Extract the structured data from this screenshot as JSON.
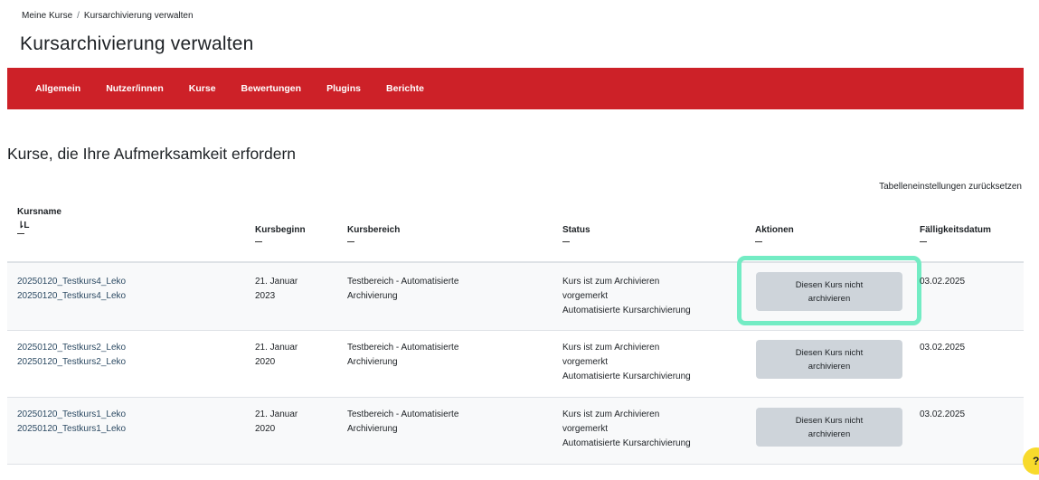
{
  "breadcrumb": {
    "item1": "Meine Kurse",
    "separator": "/",
    "item2": "Kursarchivierung verwalten"
  },
  "page_title": "Kursarchivierung verwalten",
  "nav": [
    "Allgemein",
    "Nutzer/innen",
    "Kurse",
    "Bewertungen",
    "Plugins",
    "Berichte"
  ],
  "section_title": "Kurse, die Ihre Aufmerksamkeit erfordern",
  "reset_link": "Tabelleneinstellungen zurücksetzen",
  "table": {
    "headers": {
      "kursname": "Kursname",
      "sort_icon": "⇂L",
      "kursbeginn": "Kursbeginn",
      "kursbereich": "Kursbereich",
      "status": "Status",
      "aktionen": "Aktionen",
      "faelligkeitsdatum": "Fälligkeitsdatum"
    },
    "rows": [
      {
        "name_line1": "20250120_Testkurs4_Leko",
        "name_line2": "20250120_Testkurs4_Leko",
        "begin_line1": "21. Januar",
        "begin_line2": "2023",
        "area_line1": "Testbereich - Automatisierte",
        "area_line2": "Archivierung",
        "status_line1": "Kurs ist zum Archivieren",
        "status_line2": "vorgemerkt",
        "status_line3": "Automatisierte Kursarchivierung",
        "action_line1": "Diesen Kurs nicht",
        "action_line2": "archivieren",
        "due": "03.02.2025"
      },
      {
        "name_line1": "20250120_Testkurs2_Leko",
        "name_line2": "20250120_Testkurs2_Leko",
        "begin_line1": "21. Januar",
        "begin_line2": "2020",
        "area_line1": "Testbereich - Automatisierte",
        "area_line2": "Archivierung",
        "status_line1": "Kurs ist zum Archivieren",
        "status_line2": "vorgemerkt",
        "status_line3": "Automatisierte Kursarchivierung",
        "action_line1": "Diesen Kurs nicht",
        "action_line2": "archivieren",
        "due": "03.02.2025"
      },
      {
        "name_line1": "20250120_Testkurs1_Leko",
        "name_line2": "20250120_Testkurs1_Leko",
        "begin_line1": "21. Januar",
        "begin_line2": "2020",
        "area_line1": "Testbereich - Automatisierte",
        "area_line2": "Archivierung",
        "status_line1": "Kurs ist zum Archivieren",
        "status_line2": "vorgemerkt",
        "status_line3": "Automatisierte Kursarchivierung",
        "action_line1": "Diesen Kurs nicht",
        "action_line2": "archivieren",
        "due": "03.02.2025"
      }
    ]
  },
  "help_label": "?",
  "colors": {
    "nav_background": "#cd2128",
    "highlight": "#73ecc4",
    "button": "#ced4da",
    "help": "#f8da2c"
  }
}
